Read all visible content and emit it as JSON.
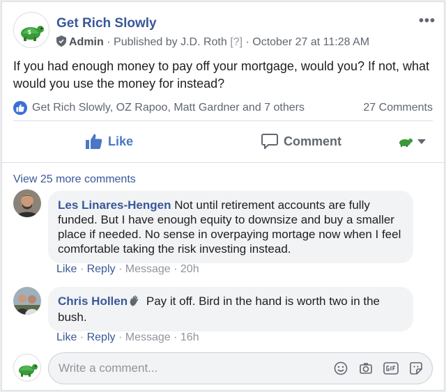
{
  "post": {
    "page_name": "Get Rich Slowly",
    "role": "Admin",
    "published_by": "Published by J.D. Roth",
    "help_marker": "[?]",
    "timestamp": "October 27 at 11:28 AM",
    "more_label": "•••",
    "text": "If you had enough money to pay off your mortgage, would you? If not, what would you use the money for instead?"
  },
  "reactions": {
    "summary": "Get Rich Slowly, OZ Rapoo, Matt Gardner and 7 others",
    "comments_count": "27 Comments"
  },
  "actions": {
    "like_label": "Like",
    "comment_label": "Comment"
  },
  "comments": {
    "view_more": "View 25 more comments",
    "items": [
      {
        "author": "Les Linares-Hengen",
        "text": "Not until retirement accounts are fully funded. But I have enough equity to downsize and buy a smaller place if needed. No sense in overpaying mortage now when I feel comfortable taking the risk investing instead.",
        "like": "Like",
        "reply": "Reply",
        "message": "Message",
        "time": "20h"
      },
      {
        "author": "Chris Hollen",
        "text": "Pay it off. Bird in the hand is worth two in the bush.",
        "like": "Like",
        "reply": "Reply",
        "message": "Message",
        "time": "16h"
      }
    ]
  },
  "composer": {
    "placeholder": "Write a comment...",
    "tools": [
      "emoji-icon",
      "camera-icon",
      "gif-icon",
      "sticker-icon"
    ]
  },
  "colors": {
    "link": "#385898",
    "accent": "#4a77c6",
    "muted": "#606770",
    "bubble": "#f2f3f5"
  }
}
